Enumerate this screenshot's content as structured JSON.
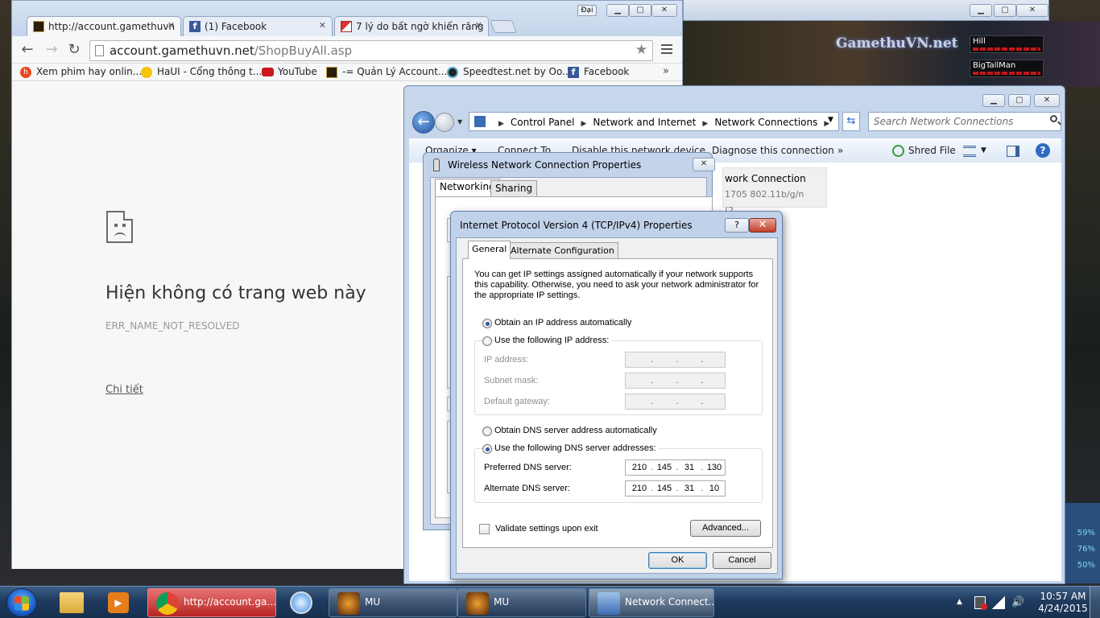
{
  "colors": {
    "accent": "#1f4f9c",
    "taskbar": "#1e3a5e",
    "chrome_tab": "#e6edf6"
  },
  "game": {
    "logo": "GamethuVN.net",
    "player1": "Hill",
    "player2": "BigTallMan",
    "pct": [
      "59%",
      "76%",
      "50%"
    ]
  },
  "chrome": {
    "tabs": [
      {
        "label": "http://account.gamethuvn",
        "icon": "game-icon"
      },
      {
        "label": "(1) Facebook",
        "icon": "facebook-icon"
      },
      {
        "label": "7 lý do bất ngờ khiến răng",
        "icon": "news-icon"
      }
    ],
    "user_label": "Đại",
    "url_host": "account.gamethuvn.net",
    "url_path": "/ShopBuyAll.asp",
    "bookmarks": [
      "Xem phim hay onlin...",
      "HaUI - Cổng thông t...",
      "YouTube",
      "-= Quản Lý Account...",
      "Speedtest.net by Oo...",
      "Facebook"
    ],
    "error_title": "Hiện không có trang web này",
    "error_code": "ERR_NAME_NOT_RESOLVED",
    "details_link": "Chi tiết"
  },
  "netconn": {
    "breadcrumb": [
      "Control Panel",
      "Network and Internet",
      "Network Connections"
    ],
    "search_placeholder": "Search Network Connections",
    "commands": [
      "Organize ▾",
      "Connect To",
      "Disable this network device",
      "Diagnose this connection",
      "»"
    ],
    "shred_file": "Shred File",
    "item_name": "work Connection",
    "item_sub": "1705 802.11b/g/n (2...."
  },
  "wireless": {
    "title": "Wireless Network Connection Properties",
    "tabs": [
      "Networking",
      "Sharing"
    ],
    "close": "✕"
  },
  "ipv4": {
    "title": "Internet Protocol Version 4 (TCP/IPv4) Properties",
    "help": "?",
    "close": "✕",
    "tabs": [
      "General",
      "Alternate Configuration"
    ],
    "description": "You can get IP settings assigned automatically if your network supports this capability. Otherwise, you need to ask your network administrator for the appropriate IP settings.",
    "obtain_ip_auto": "Obtain an IP address automatically",
    "use_following_ip": "Use the following IP address:",
    "ip_address_label": "IP address:",
    "subnet_mask_label": "Subnet mask:",
    "gateway_label": "Default gateway:",
    "obtain_dns_auto": "Obtain DNS server address automatically",
    "use_following_dns": "Use the following DNS server addresses:",
    "preferred_dns_label": "Preferred DNS server:",
    "preferred_dns": [
      "210",
      "145",
      "31",
      "130"
    ],
    "alternate_dns_label": "Alternate DNS server:",
    "alternate_dns": [
      "210",
      "145",
      "31",
      "10"
    ],
    "validate_label": "Validate settings upon exit",
    "advanced": "Advanced...",
    "ok": "OK",
    "cancel": "Cancel"
  },
  "taskbar": {
    "buttons": [
      "http://account.ga...",
      "MU",
      "MU",
      "Network Connect..."
    ],
    "time": "10:57 AM",
    "date": "4/24/2015"
  }
}
